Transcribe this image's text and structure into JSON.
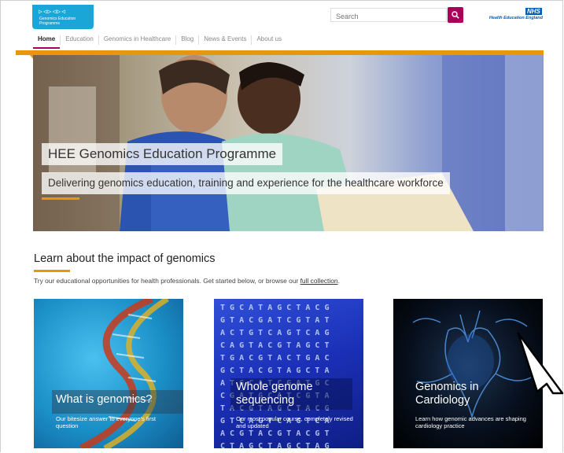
{
  "header": {
    "logo_text": "Genomics Education Programme",
    "search_placeholder": "Search",
    "nhs_badge": "NHS",
    "partner_name": "Health Education England"
  },
  "nav": {
    "items": [
      {
        "label": "Home",
        "active": true
      },
      {
        "label": "Education"
      },
      {
        "label": "Genomics in Healthcare"
      },
      {
        "label": "Blog"
      },
      {
        "label": "News & Events"
      },
      {
        "label": "About us"
      }
    ]
  },
  "hero": {
    "title": "HEE Genomics Education Programme",
    "subtitle": "Delivering genomics education, training and experience for the healthcare workforce"
  },
  "section": {
    "title": "Learn about the impact of genomics",
    "intro": "Try our educational opportunities for health professionals. Get started below, or browse our",
    "intro_link": "full collection",
    "intro_end": "."
  },
  "cards": [
    {
      "title": "What is genomics?",
      "desc": "Our bitesize answer to everyone's first question"
    },
    {
      "title_line1": "Whole genome",
      "title_line2": "sequencing",
      "desc": "Our most popular course, completely revised and updated"
    },
    {
      "title_line1": "Genomics in",
      "title_line2": "Cardiology",
      "desc": "Learn how genomic advances are shaping cardiology practice"
    }
  ],
  "colors": {
    "accent_orange": "#e8960c",
    "brand_magenta": "#a8005a",
    "logo_blue": "#1aa6d6",
    "nhs_blue": "#005eb8"
  }
}
